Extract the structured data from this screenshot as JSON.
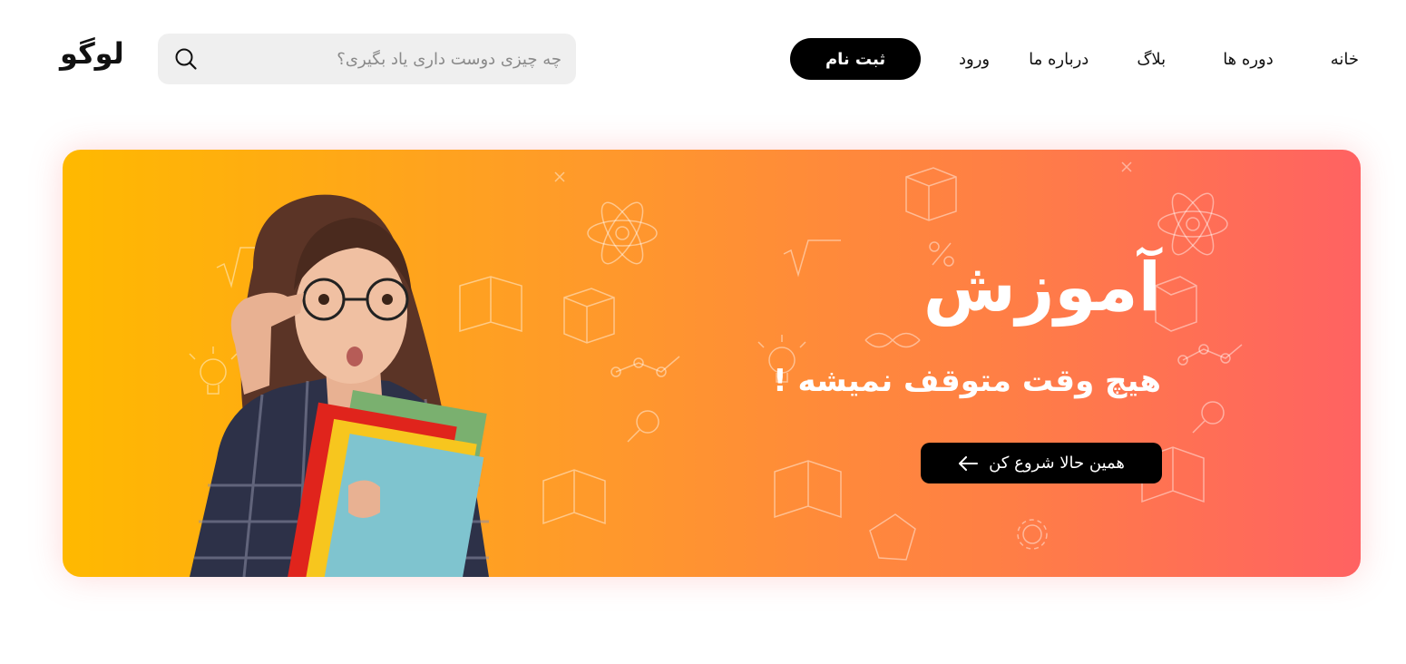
{
  "header": {
    "logo": "لوگو",
    "search_placeholder": "چه چیزی دوست داری یاد بگیری؟",
    "nav": {
      "home": "خانه",
      "courses": "دوره ها",
      "blog": "بلاگ",
      "about": "درباره ما",
      "login": "ورود",
      "register": "ثبت نام"
    }
  },
  "hero": {
    "title": "آموزش",
    "subtitle": "هیچ وقت متوقف نمیشه !",
    "cta_label": "همین حالا شروع کن"
  },
  "icons": [
    "search-icon",
    "arrow-left-icon"
  ],
  "colors": {
    "gradient_start": "#ffb900",
    "gradient_end": "#ff6262",
    "button": "#000000"
  }
}
